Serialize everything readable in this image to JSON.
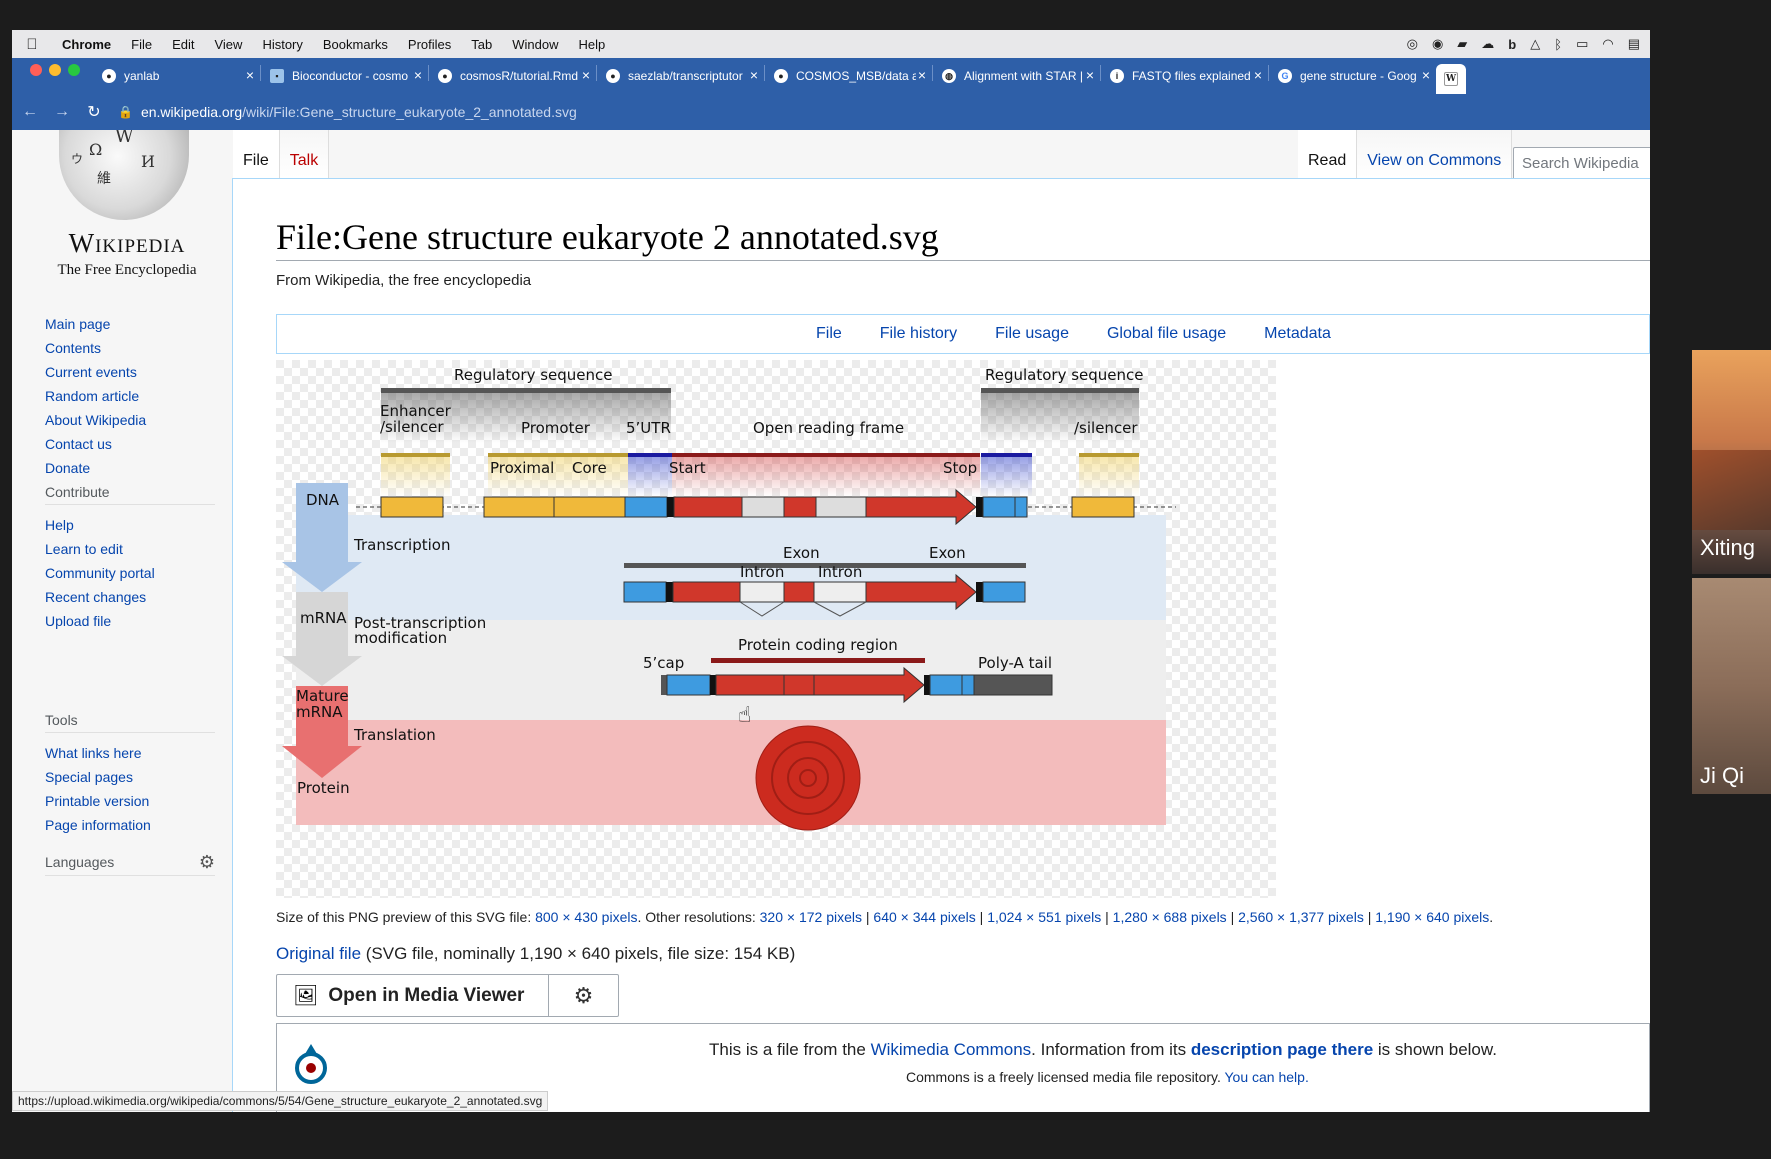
{
  "menubar": {
    "app": "Chrome",
    "items": [
      "File",
      "Edit",
      "View",
      "History",
      "Bookmarks",
      "Profiles",
      "Tab",
      "Window",
      "Help"
    ]
  },
  "tabs": [
    {
      "label": "yanlab",
      "icon": "github-icon"
    },
    {
      "label": "Bioconductor - cosmo",
      "icon": "bioconductor-icon"
    },
    {
      "label": "cosmosR/tutorial.Rmd",
      "icon": "github-icon"
    },
    {
      "label": "saezlab/transcriptutor",
      "icon": "github-icon"
    },
    {
      "label": "COSMOS_MSB/data a",
      "icon": "github-icon"
    },
    {
      "label": "Alignment with STAR |",
      "icon": "globe-icon"
    },
    {
      "label": "FASTQ files explained",
      "icon": "info-icon"
    },
    {
      "label": "gene structure - Goog",
      "icon": "google-icon"
    },
    {
      "label": "W",
      "icon": "wikipedia-icon"
    }
  ],
  "address": {
    "host": "en.wikipedia.org",
    "path": "/wiki/File:Gene_structure_eukaryote_2_annotated.svg"
  },
  "logo": {
    "wordmark": "Wikipedia",
    "tagline": "The Free Encyclopedia"
  },
  "nav": {
    "main": [
      "Main page",
      "Contents",
      "Current events",
      "Random article",
      "About Wikipedia",
      "Contact us",
      "Donate"
    ],
    "contribute_heading": "Contribute",
    "contribute": [
      "Help",
      "Learn to edit",
      "Community portal",
      "Recent changes",
      "Upload file"
    ],
    "tools_heading": "Tools",
    "tools": [
      "What links here",
      "Special pages",
      "Printable version",
      "Page information"
    ],
    "languages": "Languages"
  },
  "pagetabs": {
    "file": "File",
    "talk": "Talk",
    "read": "Read",
    "view_on_commons": "View on Commons",
    "search_placeholder": "Search Wikipedia"
  },
  "title": "File:Gene structure eukaryote 2 annotated.svg",
  "from": "From Wikipedia, the free encyclopedia",
  "filebar": [
    "File",
    "File history",
    "File usage",
    "Global file usage",
    "Metadata"
  ],
  "figure": {
    "reg_left": "Regulatory sequence",
    "reg_right": "Regulatory sequence",
    "enhancer1": "Enhancer",
    "enhancer2": "/silencer",
    "silencer_right": "/silencer",
    "promoter": "Promoter",
    "utr5": "5’UTR",
    "orf": "Open reading frame",
    "proximal": "Proximal",
    "core": "Core",
    "start": "Start",
    "stop": "Stop",
    "dna": "DNA",
    "transcription": "Transcription",
    "exon1": "Exon",
    "exon2": "Exon",
    "intron1": "Intron",
    "intron2": "Intron",
    "mrna": "mRNA",
    "ptm1": "Post-transcription",
    "ptm2": "modification",
    "pcr": "Protein coding region",
    "cap": "5’cap",
    "polya": "Poly-A tail",
    "mature1": "Mature",
    "mature2": "mRNA",
    "translation": "Translation",
    "protein": "Protein"
  },
  "sizeline": {
    "prefix": "Size of this PNG preview of this SVG file: ",
    "preview": "800 × 430 pixels",
    "other": ". Other resolutions: ",
    "res": [
      "320 × 172 pixels",
      "640 × 344 pixels",
      "1,024 × 551 pixels",
      "1,280 × 688 pixels",
      "2,560 × 1,377 pixels",
      "1,190 × 640 pixels"
    ]
  },
  "original": {
    "link": "Original file",
    "rest": " (SVG file, nominally 1,190 × 640 pixels, file size: 154 KB)"
  },
  "mediaviewer": "Open in Media Viewer",
  "commons": {
    "l1a": "This is a file from the ",
    "l1b": "Wikimedia Commons",
    "l1c": ". Information from its ",
    "l1d": "description page there",
    "l1e": " is shown below.",
    "l2a": "Commons is a freely licensed media file repository. ",
    "l2b": "You can help."
  },
  "status_url": "https://upload.wikimedia.org/wikipedia/commons/5/54/Gene_structure_eukaryote_2_annotated.svg",
  "participants": [
    "Xiting",
    "Ji Qi"
  ],
  "colors": {
    "link": "#0645ad",
    "chrome_blue": "#2e5fa8",
    "exon_red": "#d0372b",
    "utr_blue": "#3e9be0",
    "reg_yellow": "#f0b93a"
  }
}
